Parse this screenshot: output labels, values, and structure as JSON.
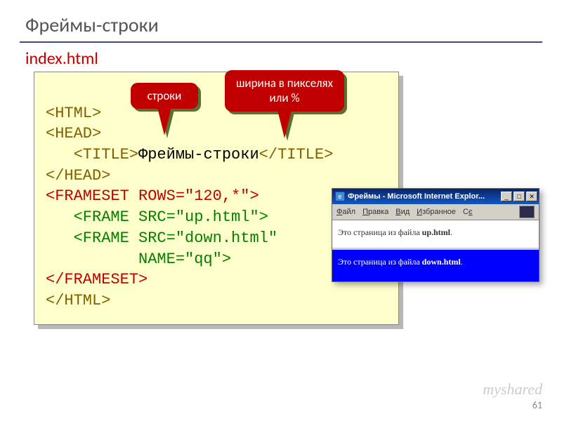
{
  "slide": {
    "title": "Фреймы-строки",
    "filename": "index.html",
    "page_number": "61",
    "watermark": "myshared"
  },
  "code": {
    "l1": "<HTML>",
    "l2": "<HEAD>",
    "l3a": "   <TITLE>",
    "l3b": "Фреймы-строки",
    "l3c": "</TITLE>",
    "l4": "</HEAD>",
    "l5": "<FRAMESET ROWS=\"120,*\">",
    "l6": "   <FRAME SRC=\"up.html\">",
    "l7a": "   <FRAME SRC=\"down.html\"",
    "l7b": "          NAME=\"qq\">",
    "l8": "</FRAMESET>",
    "l9": "</HTML>"
  },
  "callouts": {
    "rows": "строки",
    "width": "ширина в пикселях или %"
  },
  "browser": {
    "title": "Фреймы - Microsoft Internet Explor...",
    "menu": {
      "file": "Файл",
      "edit": "Правка",
      "view": "Вид",
      "fav": "Избранное",
      "svc": "Сє"
    },
    "frame_top_a": "Это страница из файла ",
    "frame_top_b": "up.html",
    "frame_top_c": ".",
    "frame_bottom_a": "Это страница из файла ",
    "frame_bottom_b": "down.html",
    "frame_bottom_c": "."
  }
}
